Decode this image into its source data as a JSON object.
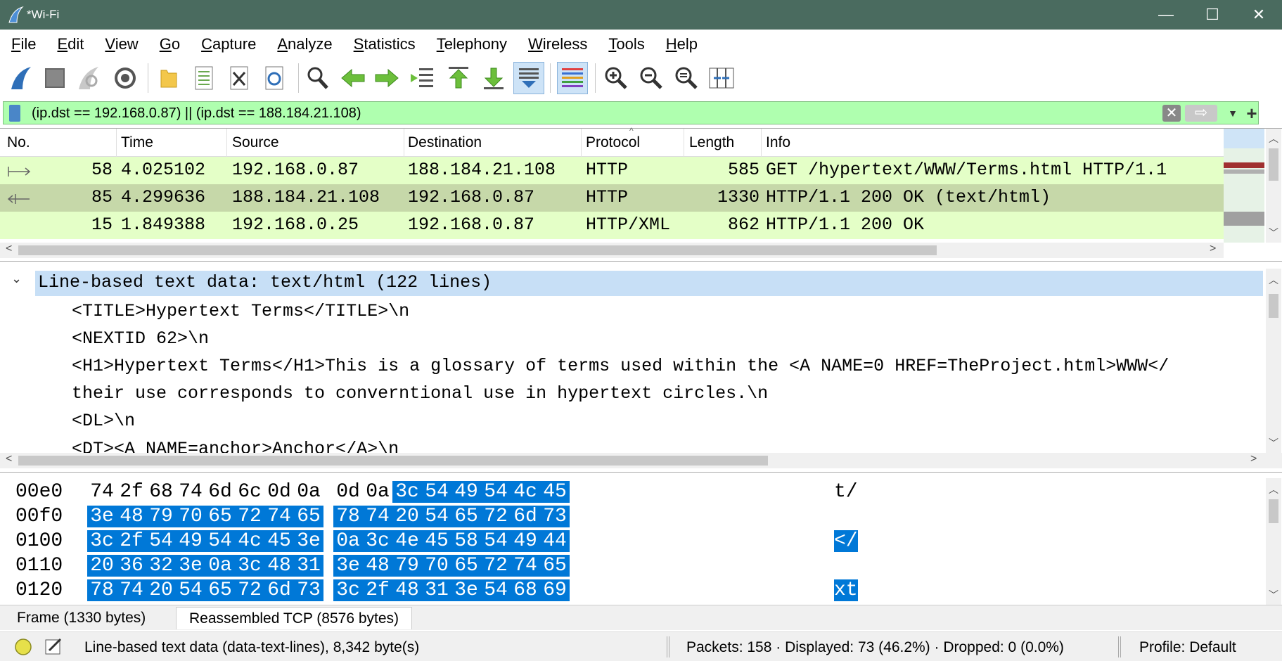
{
  "window": {
    "title": "*Wi-Fi",
    "minimize": "—",
    "maximize": "☐",
    "close": "✕"
  },
  "menu": [
    "File",
    "Edit",
    "View",
    "Go",
    "Capture",
    "Analyze",
    "Statistics",
    "Telephony",
    "Wireless",
    "Tools",
    "Help"
  ],
  "toolbar": {
    "icons": [
      "start-capture-icon",
      "stop-capture-icon",
      "restart-capture-icon",
      "capture-options-icon",
      "open-file-icon",
      "save-file-icon",
      "close-file-icon",
      "reload-file-icon",
      "find-packet-icon",
      "go-back-icon",
      "go-forward-icon",
      "go-to-packet-icon",
      "first-packet-icon",
      "last-packet-icon",
      "autoscroll-icon",
      "colorize-icon",
      "zoom-in-icon",
      "zoom-out-icon",
      "normal-size-icon",
      "resize-columns-icon"
    ]
  },
  "filter": {
    "value": "(ip.dst == 192.168.0.87) || (ip.dst == 188.184.21.108)"
  },
  "packet_list": {
    "columns": [
      "No.",
      "Time",
      "Source",
      "Destination",
      "Protocol",
      "Length",
      "Info"
    ],
    "rows": [
      {
        "no": "58",
        "time": "4.025102",
        "source": "192.168.0.87",
        "destination": "188.184.21.108",
        "protocol": "HTTP",
        "length": "585",
        "info": "GET /hypertext/WWW/Terms.html HTTP/1.1"
      },
      {
        "no": "85",
        "time": "4.299636",
        "source": "188.184.21.108",
        "destination": "192.168.0.87",
        "protocol": "HTTP",
        "length": "1330",
        "info": "HTTP/1.1 200 OK  (text/html)"
      },
      {
        "no": "15",
        "time": "1.849388",
        "source": "192.168.0.25",
        "destination": "192.168.0.87",
        "protocol": "HTTP/XML",
        "length": "862",
        "info": "HTTP/1.1 200 OK"
      }
    ],
    "colors": {
      "row_bg": "#e4ffc7",
      "row_selected": "#c6d8a9"
    }
  },
  "details": {
    "header": "Line-based text data: text/html (122 lines)",
    "lines": [
      "<TITLE>Hypertext Terms</TITLE>\\n",
      "<NEXTID 62>\\n",
      "<H1>Hypertext Terms</H1>This is a glossary of terms used within the <A NAME=0 HREF=TheProject.html>WWW</",
      "their use corresponds to converntional use in hypertext circles.\\n",
      "<DL>\\n",
      "<DT><A NAME=anchor>Anchor</A>\\n"
    ]
  },
  "bytes": {
    "rows": [
      {
        "offset": "00e0",
        "hex": [
          "74",
          "2f",
          "68",
          "74",
          "6d",
          "6c",
          "0d",
          "0a",
          "0d",
          "0a",
          "3c",
          "54",
          "49",
          "54",
          "4c",
          "45"
        ],
        "hl_from": 10,
        "ascii": "t/",
        "ascii_hl": false
      },
      {
        "offset": "00f0",
        "hex": [
          "3e",
          "48",
          "79",
          "70",
          "65",
          "72",
          "74",
          "65",
          "78",
          "74",
          "20",
          "54",
          "65",
          "72",
          "6d",
          "73"
        ],
        "hl_from": 0,
        "ascii": "",
        "ascii_hl": false
      },
      {
        "offset": "0100",
        "hex": [
          "3c",
          "2f",
          "54",
          "49",
          "54",
          "4c",
          "45",
          "3e",
          "0a",
          "3c",
          "4e",
          "45",
          "58",
          "54",
          "49",
          "44"
        ],
        "hl_from": 0,
        "ascii": "</",
        "ascii_hl": true
      },
      {
        "offset": "0110",
        "hex": [
          "20",
          "36",
          "32",
          "3e",
          "0a",
          "3c",
          "48",
          "31",
          "3e",
          "48",
          "79",
          "70",
          "65",
          "72",
          "74",
          "65"
        ],
        "hl_from": 0,
        "ascii": "",
        "ascii_hl": false
      },
      {
        "offset": "0120",
        "hex": [
          "78",
          "74",
          "20",
          "54",
          "65",
          "72",
          "6d",
          "73",
          "3c",
          "2f",
          "48",
          "31",
          "3e",
          "54",
          "68",
          "69"
        ],
        "hl_from": 0,
        "ascii": "xt",
        "ascii_hl": true
      }
    ]
  },
  "tabs": [
    "Frame (1330 bytes)",
    "Reassembled TCP (8576 bytes)"
  ],
  "status": {
    "field": "Line-based text data (data-text-lines), 8,342 byte(s)",
    "packets": "Packets: 158 · Displayed: 73 (46.2%) · Dropped: 0 (0.0%)",
    "profile": "Profile: Default"
  }
}
